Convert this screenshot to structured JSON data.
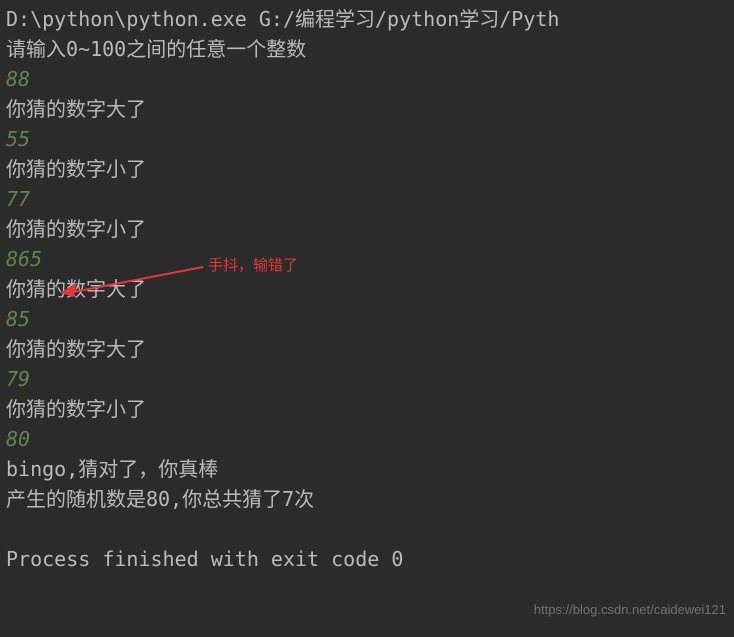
{
  "path": "D:\\python\\python.exe G:/编程学习/python学习/Pyth",
  "prompt": "请输入0~100之间的任意一个整数",
  "guesses": [
    {
      "input": "88",
      "response": "你猜的数字大了"
    },
    {
      "input": "55",
      "response": "你猜的数字小了"
    },
    {
      "input": "77",
      "response": "你猜的数字小了"
    },
    {
      "input": "865",
      "response": "你猜的数字大了"
    },
    {
      "input": "85",
      "response": "你猜的数字大了"
    },
    {
      "input": "79",
      "response": "你猜的数字小了"
    },
    {
      "input": "80",
      "response": ""
    }
  ],
  "bingo": "bingo,猜对了，你真棒",
  "summary": "产生的随机数是80,你总共猜了7次",
  "exit_line": "Process finished with exit code 0",
  "annotation": "手抖，输错了",
  "watermark": "https://blog.csdn.net/caidewei121"
}
